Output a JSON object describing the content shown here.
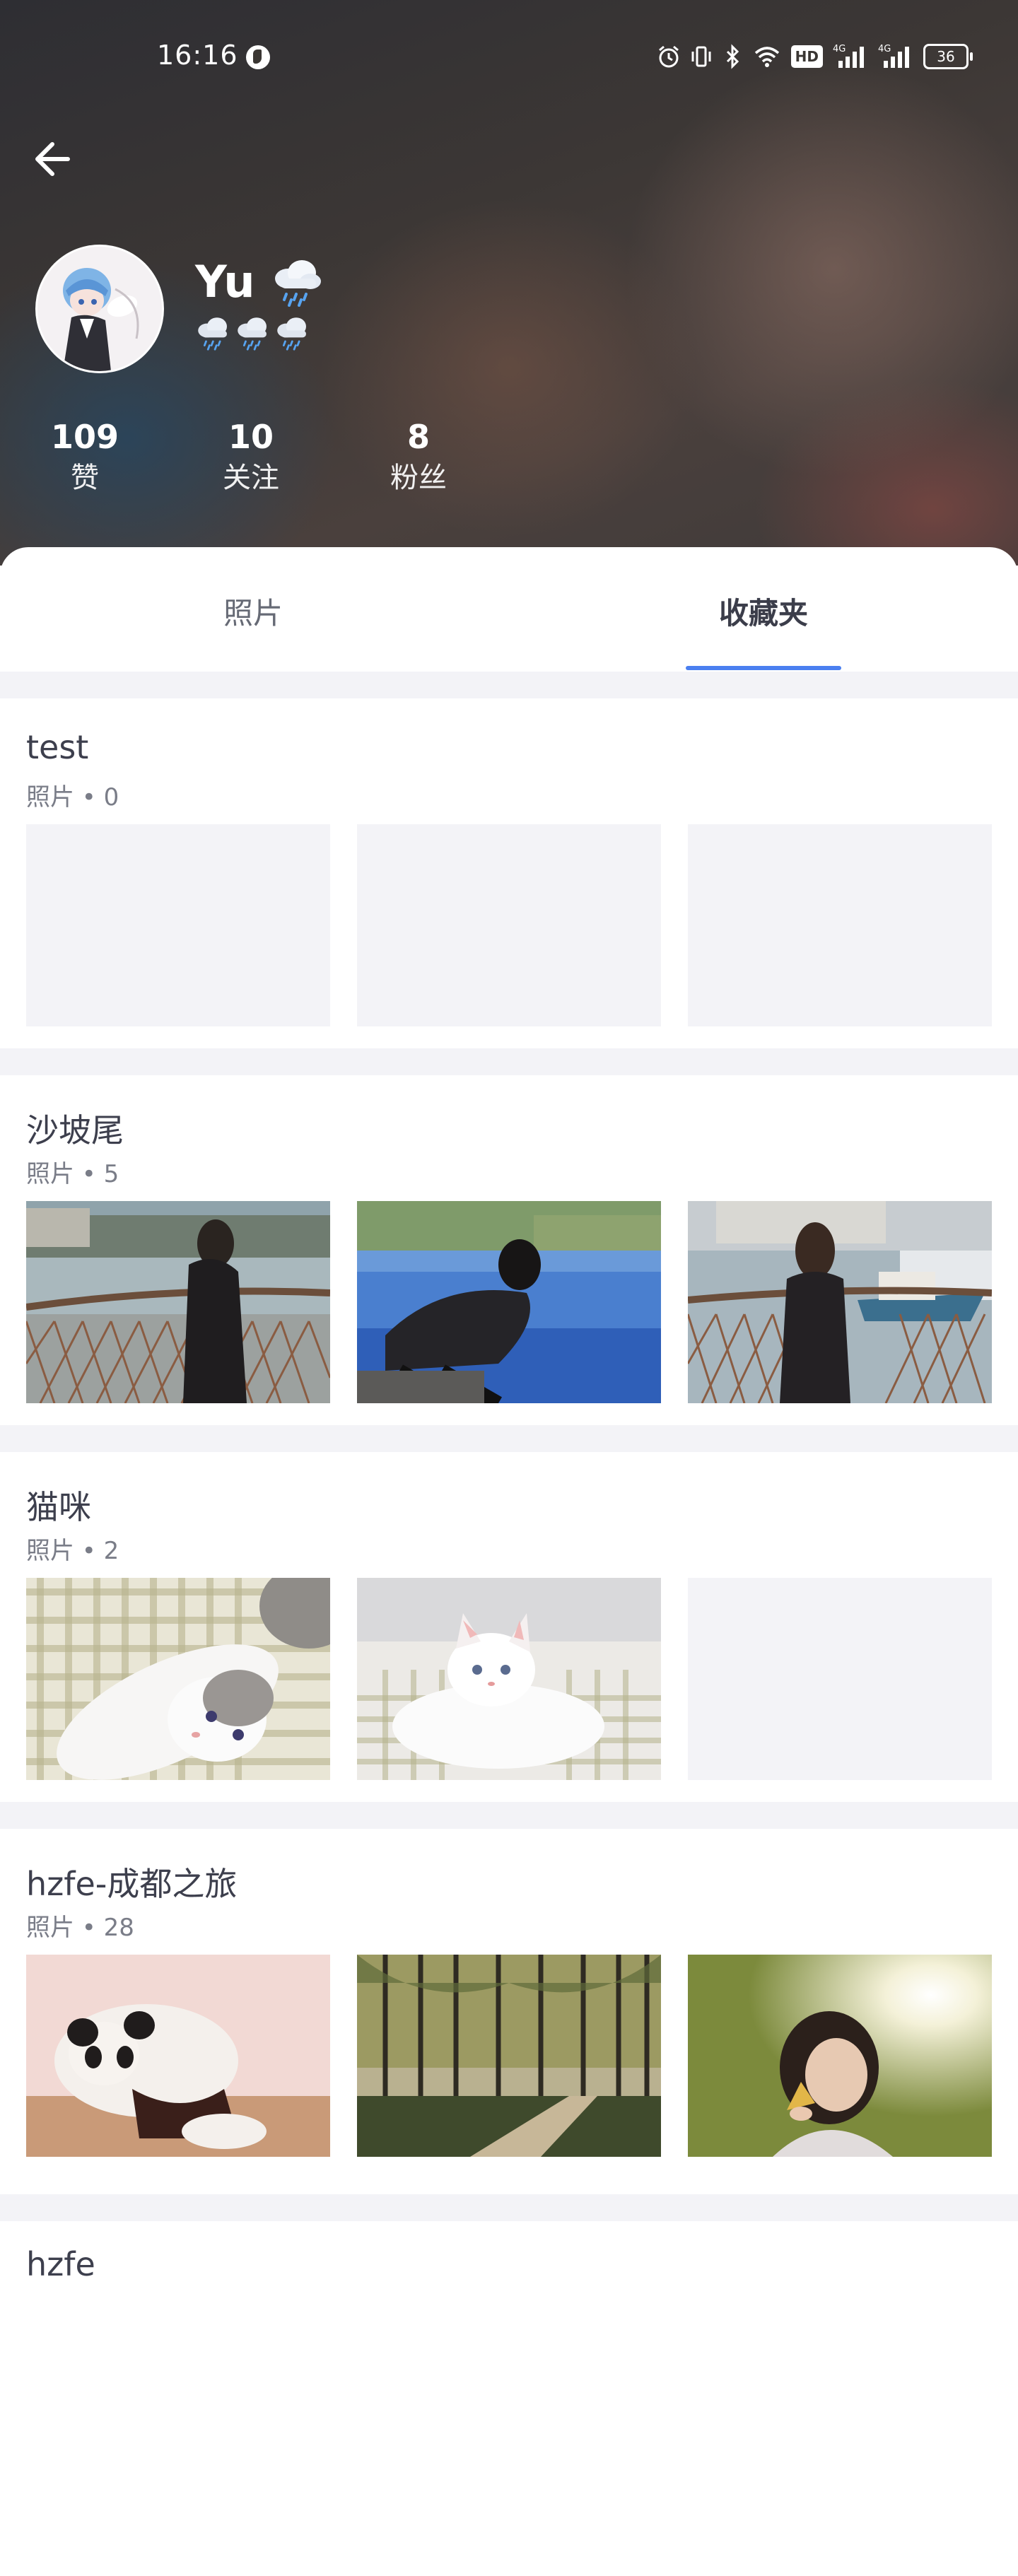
{
  "status_bar": {
    "time": "16:16",
    "battery": "36",
    "hd_label": "HD",
    "network_labels": [
      "4G",
      "4G"
    ]
  },
  "profile": {
    "name": "Yu",
    "stats": [
      {
        "value": "109",
        "label": "赞"
      },
      {
        "value": "10",
        "label": "关注"
      },
      {
        "value": "8",
        "label": "粉丝"
      }
    ]
  },
  "tabs": [
    {
      "label": "照片",
      "active": false
    },
    {
      "label": "收藏夹",
      "active": true
    }
  ],
  "collections": [
    {
      "title": "test",
      "subtitle": "照片 • 0",
      "thumbs": [
        "empty",
        "empty",
        "empty"
      ]
    },
    {
      "title": "沙坡尾",
      "subtitle": "照片 • 5",
      "thumbs": [
        "girl-railing-photo",
        "girl-crouching-water-photo",
        "girl-harbor-boat-photo"
      ]
    },
    {
      "title": "猫咪",
      "subtitle": "照片 • 2",
      "thumbs": [
        "kitten-lying-photo",
        "kitten-sitting-photo",
        "empty"
      ]
    },
    {
      "title": "hzfe-成都之旅",
      "subtitle": "照片 • 28",
      "thumbs": [
        "panda-cub-photo",
        "forest-path-photo",
        "girl-sunlight-leaf-photo"
      ]
    },
    {
      "title": "hzfe",
      "subtitle": "",
      "thumbs": []
    }
  ],
  "colors": {
    "accent": "#4a7ff0",
    "page_bg": "#f3f3f7",
    "title_text": "#3d3f4d",
    "sub_text": "#7a7d88"
  }
}
